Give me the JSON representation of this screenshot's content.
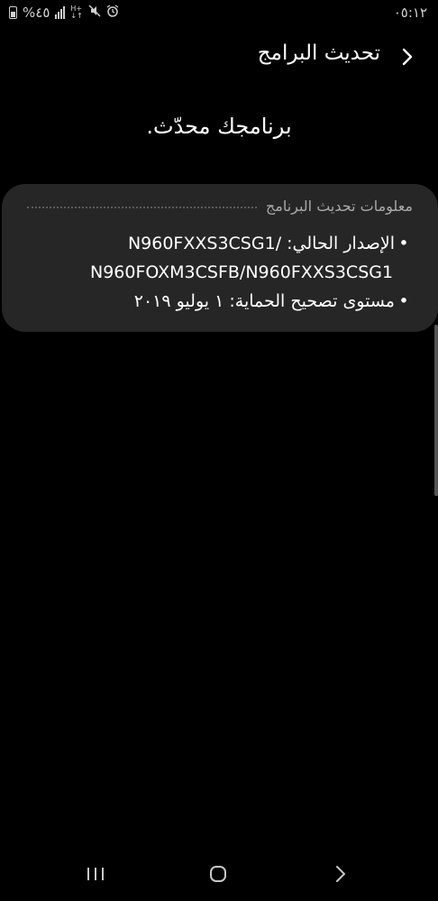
{
  "status_bar": {
    "battery": "%٤٥",
    "time": "٠٥:١٢",
    "network_top": "H+",
    "network_bottom": "↓↑"
  },
  "header": {
    "title": "تحديث البرامج"
  },
  "main": {
    "status_message": "برنامجك محدّث."
  },
  "info_card": {
    "heading": "معلومات تحديث البرنامج",
    "items": [
      {
        "text": "الإصدار الحالي: /N960FXXS3CSG1\nN960FOXM3CSFB/N960FXXS3CSG1"
      },
      {
        "text": "مستوى تصحيح الحماية: ١ يوليو ٢٠١٩"
      }
    ]
  },
  "nav_bar": {
    "icons": [
      "recent-apps-icon",
      "home-icon",
      "back-icon"
    ]
  }
}
